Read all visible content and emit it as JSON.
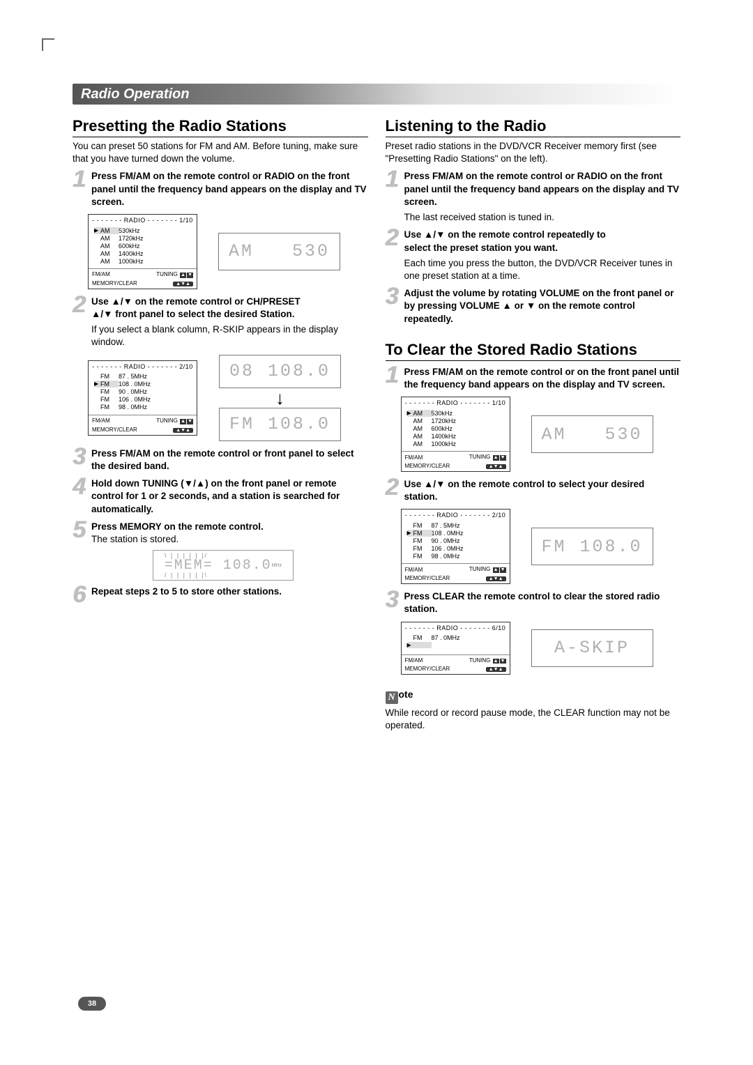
{
  "page_number": "38",
  "title_bar": "Radio Operation",
  "left": {
    "heading": "Presetting the Radio Stations",
    "intro": "You can preset 50 stations for FM and AM. Before tuning, make sure that you have turned down the volume.",
    "step1": "Press FM/AM on the remote control or RADIO on the front panel until the frequency band appears on the display and TV screen.",
    "step2_l1": "Use ▲/▼ on the remote control or CH/PRESET",
    "step2_l2": "▲/▼ front panel to select the desired Station.",
    "step2_sub": "If you select a blank column, R-SKIP appears in the display window.",
    "step3": "Press FM/AM on the remote control or front panel to select the desired band.",
    "step4": "Hold down TUNING (▼/▲) on the front panel or remote control for 1 or 2 seconds, and a station is searched for automatically.",
    "step5_bold": "Press MEMORY on the remote control.",
    "step5_sub": "The station is stored.",
    "step6": "Repeat steps 2 to 5 to store other stations.",
    "osd1": {
      "hdr": "- - - - - - - RADIO - - - - - - - 1/10",
      "rows": [
        {
          "sel": true,
          "band": "AM",
          "freq": "530kHz"
        },
        {
          "sel": false,
          "band": "AM",
          "freq": "1720kHz"
        },
        {
          "sel": false,
          "band": "AM",
          "freq": "600kHz"
        },
        {
          "sel": false,
          "band": "AM",
          "freq": "1400kHz"
        },
        {
          "sel": false,
          "band": "AM",
          "freq": "1000kHz"
        }
      ],
      "foot_l1_left": "FM/AM",
      "foot_l1_right": "TUNING",
      "foot_l2_left": "MEMORY/CLEAR"
    },
    "lcd1_band": "AM",
    "lcd1_val": "530",
    "osd2": {
      "hdr": "- - - - - - - RADIO - - - - - - - 2/10",
      "rows": [
        {
          "sel": false,
          "band": "FM",
          "freq": "87 . 5MHz"
        },
        {
          "sel": true,
          "band": "FM",
          "freq": "108 . 0MHz"
        },
        {
          "sel": false,
          "band": "FM",
          "freq": "90 . 0MHz"
        },
        {
          "sel": false,
          "band": "FM",
          "freq": "106 . 0MHz"
        },
        {
          "sel": false,
          "band": "FM",
          "freq": "98 . 0MHz"
        }
      ],
      "foot_l1_left": "FM/AM",
      "foot_l1_right": "TUNING",
      "foot_l2_left": "MEMORY/CLEAR"
    },
    "lcd2a_left": "08",
    "lcd2a_right": "108.0",
    "lcd2b_left": "FM",
    "lcd2b_right": "108.0",
    "mem_lcd": "=MEM= 108.0",
    "mem_unit": "MHz"
  },
  "right": {
    "heading1": "Listening to the Radio",
    "intro1": "Preset radio stations in the DVD/VCR Receiver memory first (see \"Presetting Radio Stations\" on the left).",
    "r_step1": "Press FM/AM on the remote control or RADIO on the front panel until the frequency band appears on the display and TV screen.",
    "r_step1_sub": "The last received station is tuned in.",
    "r_step2_l1": "Use ▲/▼ on the remote control repeatedly to",
    "r_step2_l2": "select the preset station you want.",
    "r_step2_sub": "Each time you press the button, the DVD/VCR Receiver tunes in one preset station at a time.",
    "r_step3": "Adjust the volume by rotating VOLUME on the front panel or by pressing VOLUME ▲ or ▼ on the remote control repeatedly.",
    "heading2": "To Clear the Stored Radio Stations",
    "c_step1": "Press FM/AM on the remote control or on the front panel until the frequency band appears on the display and TV screen.",
    "osd3": {
      "hdr": "- - - - - - - RADIO - - - - - - - 1/10",
      "rows": [
        {
          "sel": true,
          "band": "AM",
          "freq": "530kHz"
        },
        {
          "sel": false,
          "band": "AM",
          "freq": "1720kHz"
        },
        {
          "sel": false,
          "band": "AM",
          "freq": "600kHz"
        },
        {
          "sel": false,
          "band": "AM",
          "freq": "1400kHz"
        },
        {
          "sel": false,
          "band": "AM",
          "freq": "1000kHz"
        }
      ],
      "foot_l1_left": "FM/AM",
      "foot_l1_right": "TUNING",
      "foot_l2_left": "MEMORY/CLEAR"
    },
    "lcd3_band": "AM",
    "lcd3_val": "530",
    "c_step2": "Use ▲/▼ on the remote control to select your desired station.",
    "osd4": {
      "hdr": "- - - - - - - RADIO - - - - - - - 2/10",
      "rows": [
        {
          "sel": false,
          "band": "FM",
          "freq": "87 . 5MHz"
        },
        {
          "sel": true,
          "band": "FM",
          "freq": "108 . 0MHz"
        },
        {
          "sel": false,
          "band": "FM",
          "freq": "90 . 0MHz"
        },
        {
          "sel": false,
          "band": "FM",
          "freq": "106 . 0MHz"
        },
        {
          "sel": false,
          "band": "FM",
          "freq": "98 . 0MHz"
        }
      ],
      "foot_l1_left": "FM/AM",
      "foot_l1_right": "TUNING",
      "foot_l2_left": "MEMORY/CLEAR"
    },
    "lcd4_band": "FM",
    "lcd4_val": "108.0",
    "c_step3": "Press CLEAR the remote control to clear the stored radio station.",
    "osd5": {
      "hdr": "- - - - - - - RADIO - - - - - - - 6/10",
      "rows": [
        {
          "sel": false,
          "band": "FM",
          "freq": "87 . 0MHz"
        },
        {
          "sel": true,
          "band": "",
          "freq": ""
        },
        {
          "sel": false,
          "band": "",
          "freq": ""
        },
        {
          "sel": false,
          "band": "",
          "freq": ""
        },
        {
          "sel": false,
          "band": "",
          "freq": ""
        }
      ],
      "foot_l1_left": "FM/AM",
      "foot_l1_right": "TUNING",
      "foot_l2_left": "MEMORY/CLEAR"
    },
    "lcd5_val": "A-SKIP",
    "note_label": "ote",
    "note_text": "While record or record pause mode, the CLEAR function may not be operated."
  }
}
